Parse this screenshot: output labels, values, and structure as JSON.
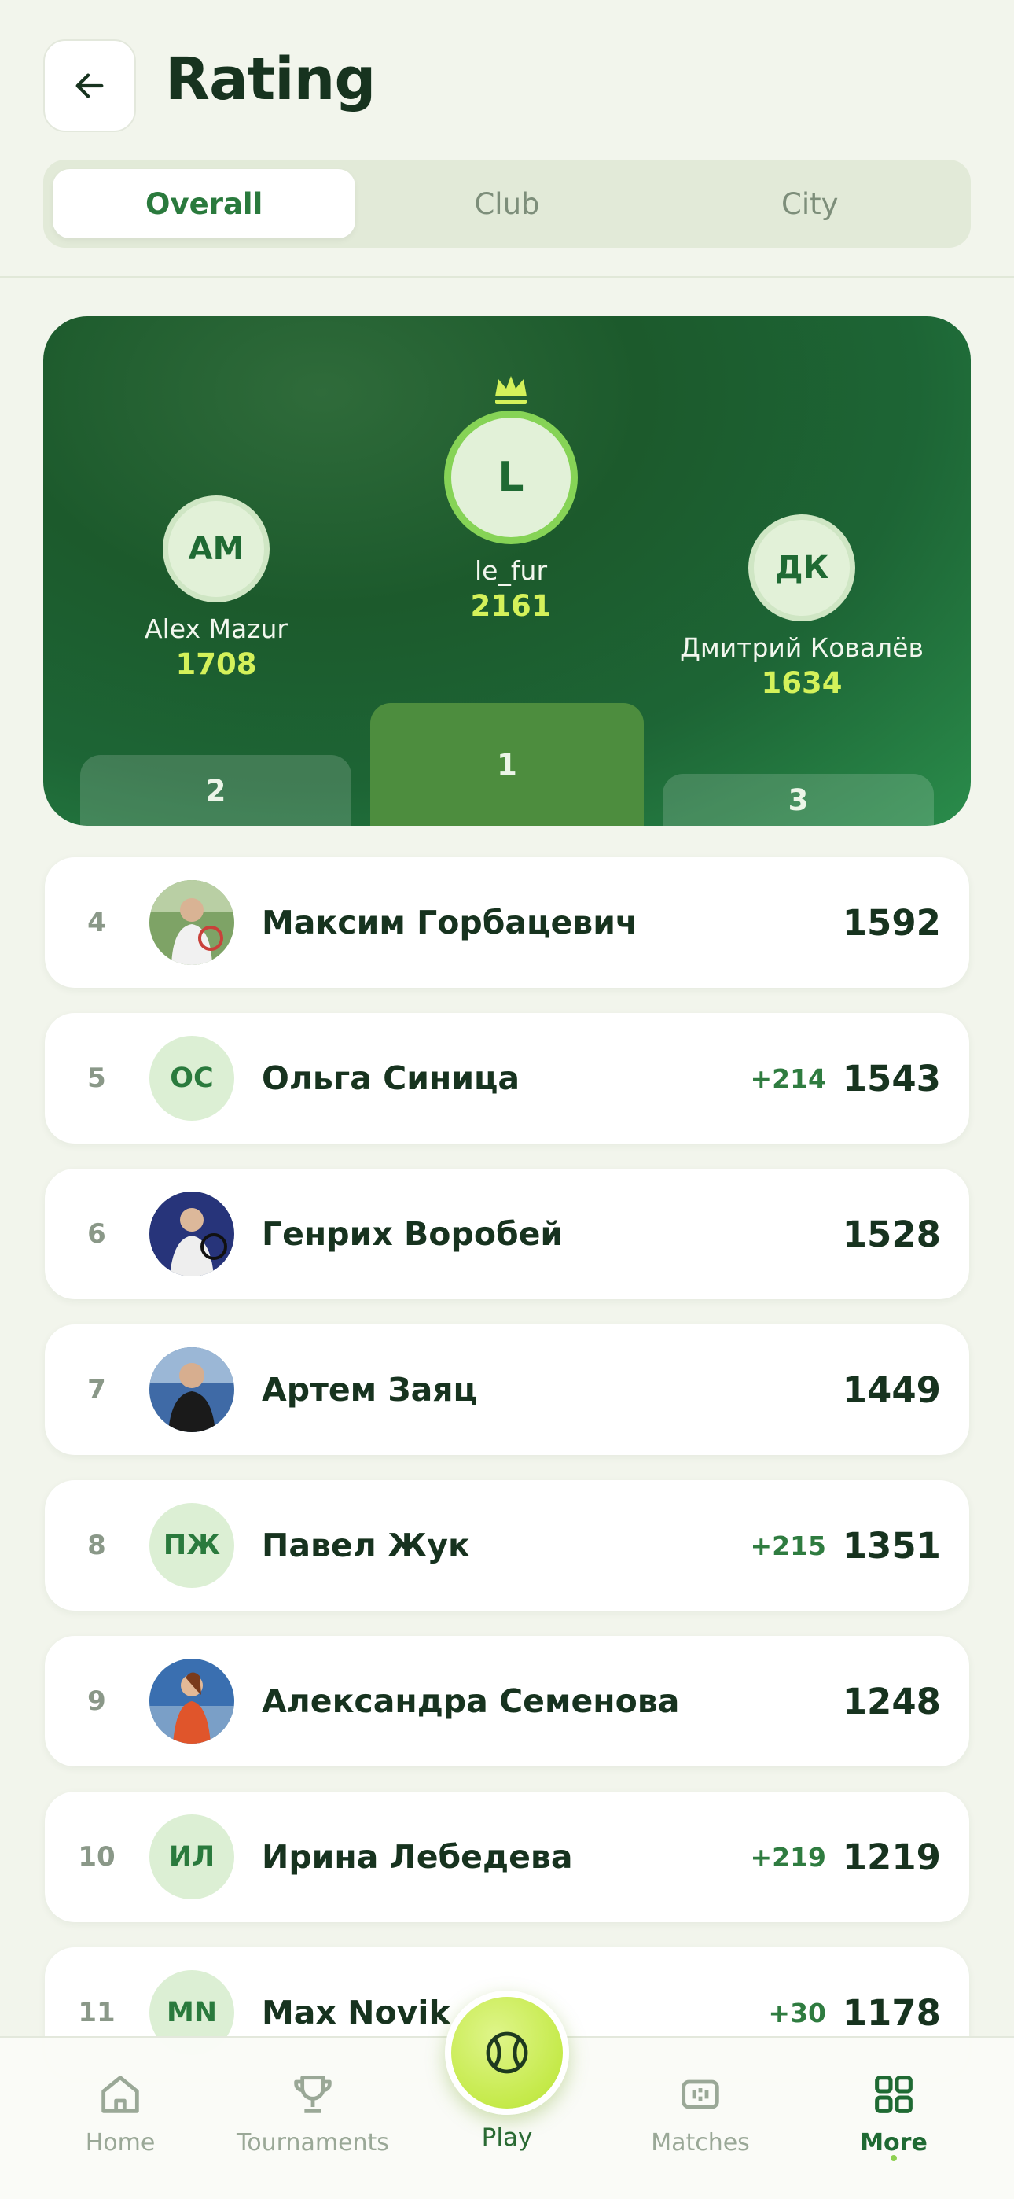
{
  "header": {
    "title": "Rating",
    "tabs": [
      {
        "label": "Overall",
        "active": true
      },
      {
        "label": "Club",
        "active": false
      },
      {
        "label": "City",
        "active": false
      }
    ]
  },
  "podium": {
    "first": {
      "initials": "L",
      "name": "le_fur",
      "score": "2161",
      "place": "1"
    },
    "second": {
      "initials": "AM",
      "name": "Alex Mazur",
      "score": "1708",
      "place": "2"
    },
    "third": {
      "initials": "ДК",
      "name": "Дмитрий Ковалёв",
      "score": "1634",
      "place": "3"
    }
  },
  "rows": [
    {
      "rank": "4",
      "initials": "",
      "photo": true,
      "name": "Максим Горбацевич",
      "delta": "",
      "score": "1592"
    },
    {
      "rank": "5",
      "initials": "ОС",
      "photo": false,
      "name": "Ольга Синица",
      "delta": "+214",
      "score": "1543"
    },
    {
      "rank": "6",
      "initials": "",
      "photo": true,
      "name": "Генрих Воробей",
      "delta": "",
      "score": "1528"
    },
    {
      "rank": "7",
      "initials": "",
      "photo": true,
      "name": "Артем Заяц",
      "delta": "",
      "score": "1449"
    },
    {
      "rank": "8",
      "initials": "ПЖ",
      "photo": false,
      "name": "Павел Жук",
      "delta": "+215",
      "score": "1351"
    },
    {
      "rank": "9",
      "initials": "",
      "photo": true,
      "name": "Александра Семенова",
      "delta": "",
      "score": "1248"
    },
    {
      "rank": "10",
      "initials": "ИЛ",
      "photo": false,
      "name": "Ирина Лебедева",
      "delta": "+219",
      "score": "1219"
    },
    {
      "rank": "11",
      "initials": "MN",
      "photo": false,
      "name": "Max Novik",
      "delta": "+30",
      "score": "1178"
    }
  ],
  "nav": {
    "home": "Home",
    "tournaments": "Tournaments",
    "play": "Play",
    "matches": "Matches",
    "more": "More"
  },
  "colors": {
    "accent": "#1f6a33",
    "lime": "#c5ea4a",
    "score_lime": "#d4f15a",
    "background": "#f2f5ec"
  },
  "icons": {
    "back": "arrow-left-icon",
    "crown": "crown-icon",
    "home": "home-icon",
    "tournaments": "trophy-icon",
    "play": "tennis-ball-icon",
    "matches": "scoreboard-icon",
    "more": "grid-icon"
  }
}
